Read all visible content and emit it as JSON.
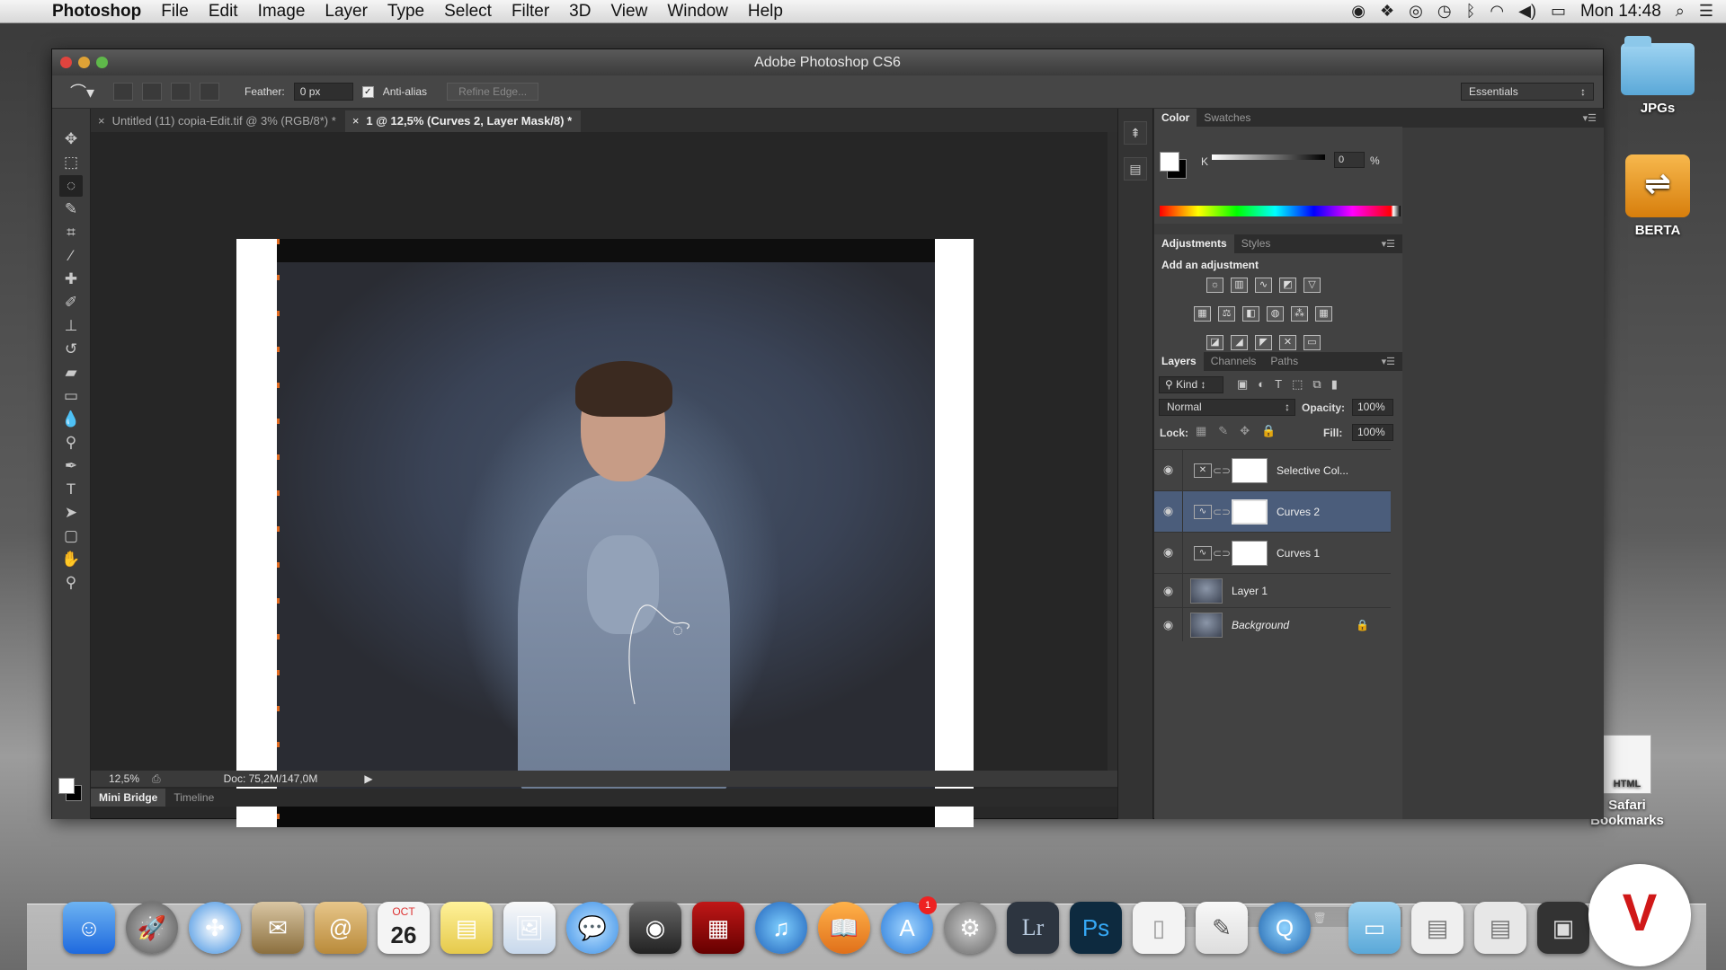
{
  "menubar": {
    "app": "Photoshop",
    "items": [
      "File",
      "Edit",
      "Image",
      "Layer",
      "Type",
      "Select",
      "Filter",
      "3D",
      "View",
      "Window",
      "Help"
    ],
    "clock": "Mon 14:48",
    "status_icons": [
      "record-icon",
      "dropbox-icon",
      "sync-icon",
      "time-machine-icon",
      "bluetooth-icon",
      "wifi-icon",
      "volume-icon",
      "battery-icon",
      "spotlight-icon",
      "list-icon"
    ]
  },
  "desktop": {
    "icons": [
      {
        "label": "JPGs",
        "type": "folder"
      },
      {
        "label": "BERTA",
        "type": "usb-drive"
      },
      {
        "label": "Safari Bookmarks",
        "type": "html-file",
        "doc_label": "HTML"
      }
    ]
  },
  "window": {
    "title": "Adobe Photoshop CS6",
    "options": {
      "feather_label": "Feather:",
      "feather_value": "0 px",
      "antialias_label": "Anti-alias",
      "antialias_checked": true,
      "refine_edge": "Refine Edge...",
      "workspace": "Essentials"
    },
    "tabs": [
      {
        "label": "Untitled (11) copia-Edit.tif @ 3% (RGB/8*) *",
        "active": false
      },
      {
        "label": "1 @ 12,5% (Curves 2, Layer Mask/8) *",
        "active": true
      }
    ],
    "status": {
      "zoom": "12,5%",
      "doc": "Doc: 75,2M/147,0M"
    },
    "bottom_tabs": [
      "Mini Bridge",
      "Timeline"
    ],
    "color_panel": {
      "tabs": [
        "Color",
        "Swatches"
      ],
      "channel": "K",
      "value": "0",
      "unit": "%"
    },
    "adjustments_panel": {
      "tabs": [
        "Adjustments",
        "Styles"
      ],
      "title": "Add an adjustment"
    },
    "layers_panel": {
      "tabs": [
        "Layers",
        "Channels",
        "Paths"
      ],
      "filter": "Kind",
      "blend_mode": "Normal",
      "opacity_label": "Opacity:",
      "opacity": "100%",
      "lock_label": "Lock:",
      "fill_label": "Fill:",
      "fill": "100%",
      "layers": [
        {
          "name": "Selective Col...",
          "kind": "adjustment",
          "selected": false
        },
        {
          "name": "Curves 2",
          "kind": "adjustment",
          "selected": true
        },
        {
          "name": "Curves 1",
          "kind": "adjustment",
          "selected": false
        },
        {
          "name": "Layer 1",
          "kind": "pixel",
          "selected": false
        },
        {
          "name": "Background",
          "kind": "pixel",
          "selected": false,
          "locked": true
        }
      ]
    }
  },
  "dock": {
    "apps": [
      "Finder",
      "Launchpad",
      "Safari",
      "Mail",
      "Contacts",
      "Calendar",
      "Notes",
      "Preview",
      "Messages",
      "FaceTime",
      "Photo Booth",
      "iTunes",
      "iBooks",
      "App Store",
      "System Preferences",
      "Lightroom",
      "Photoshop",
      "TextEdit",
      "Script Editor",
      "QuickTime"
    ],
    "calendar_day": "26",
    "calendar_month": "OCT",
    "app_store_badge": "1",
    "lr_label": "Lr",
    "ps_label": "Ps"
  },
  "colors": {
    "ps_bg": "#282828",
    "panel": "#424242",
    "selected_layer": "#4b5d7b",
    "brand_logo": "#d01818"
  }
}
